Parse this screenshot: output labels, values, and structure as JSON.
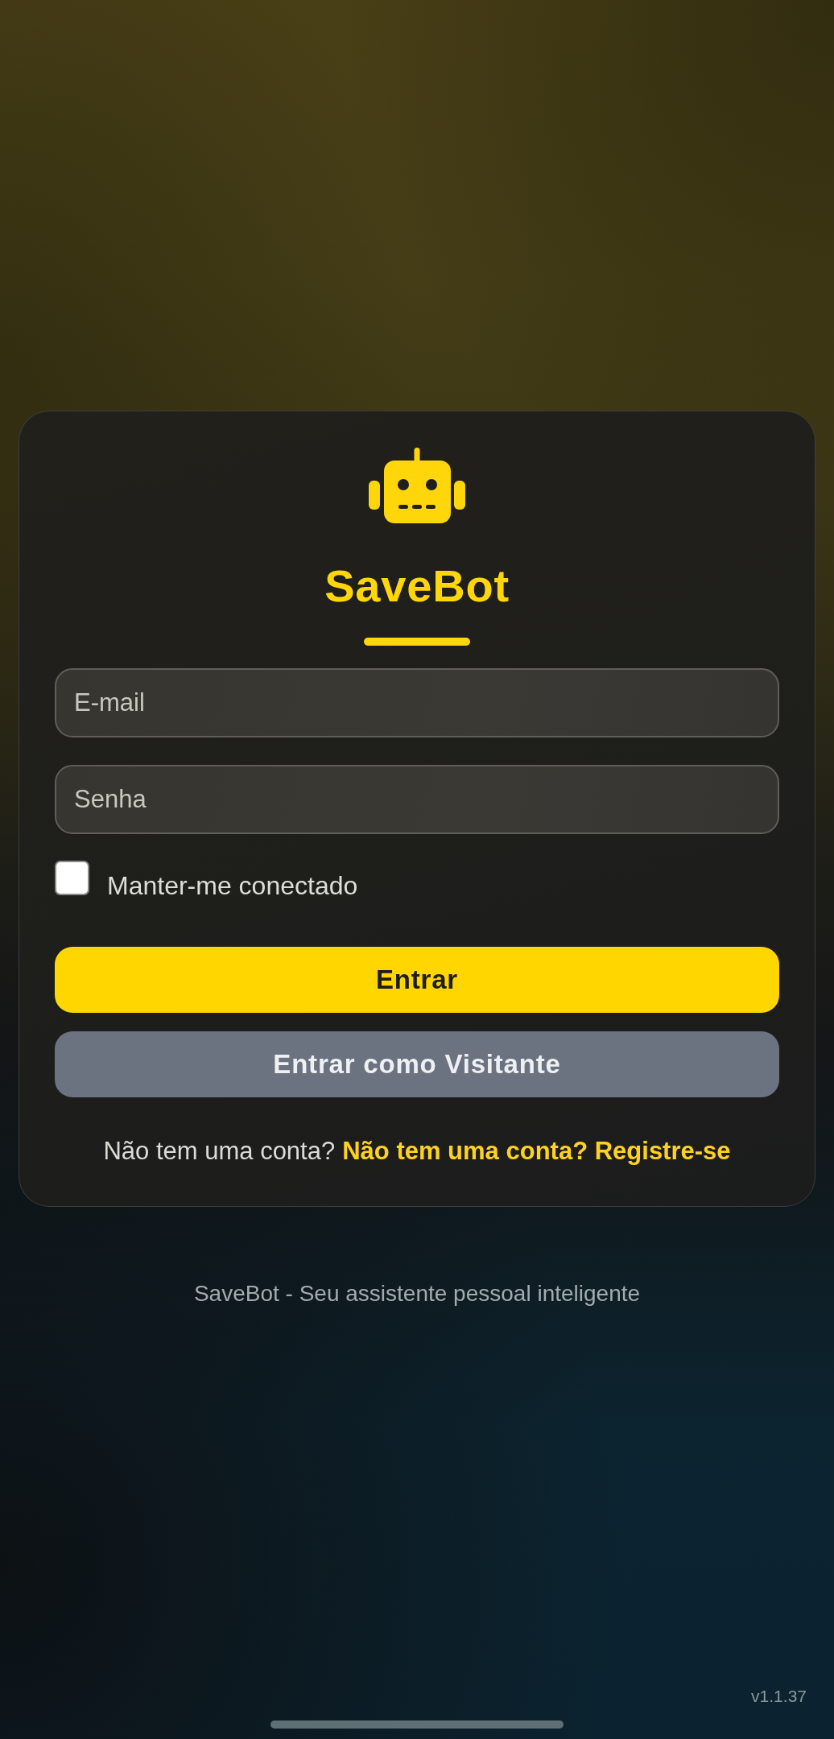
{
  "brand": {
    "title": "SaveBot"
  },
  "form": {
    "fields": [
      {
        "placeholder": "E-mail"
      },
      {
        "placeholder": "Senha"
      }
    ],
    "remember": {
      "label": "Manter-me conectado",
      "checked": false
    }
  },
  "buttons": [
    {
      "kind": "primary",
      "label": "Entrar"
    },
    {
      "kind": "secondary",
      "label": "Entrar como Visitante"
    }
  ],
  "signup": {
    "prompt": "Não tem uma conta?",
    "link": "Não tem uma conta? Registre-se"
  },
  "footer": {
    "tagline": "SaveBot - Seu assistente pessoal inteligente",
    "version": "v1.1.37"
  }
}
